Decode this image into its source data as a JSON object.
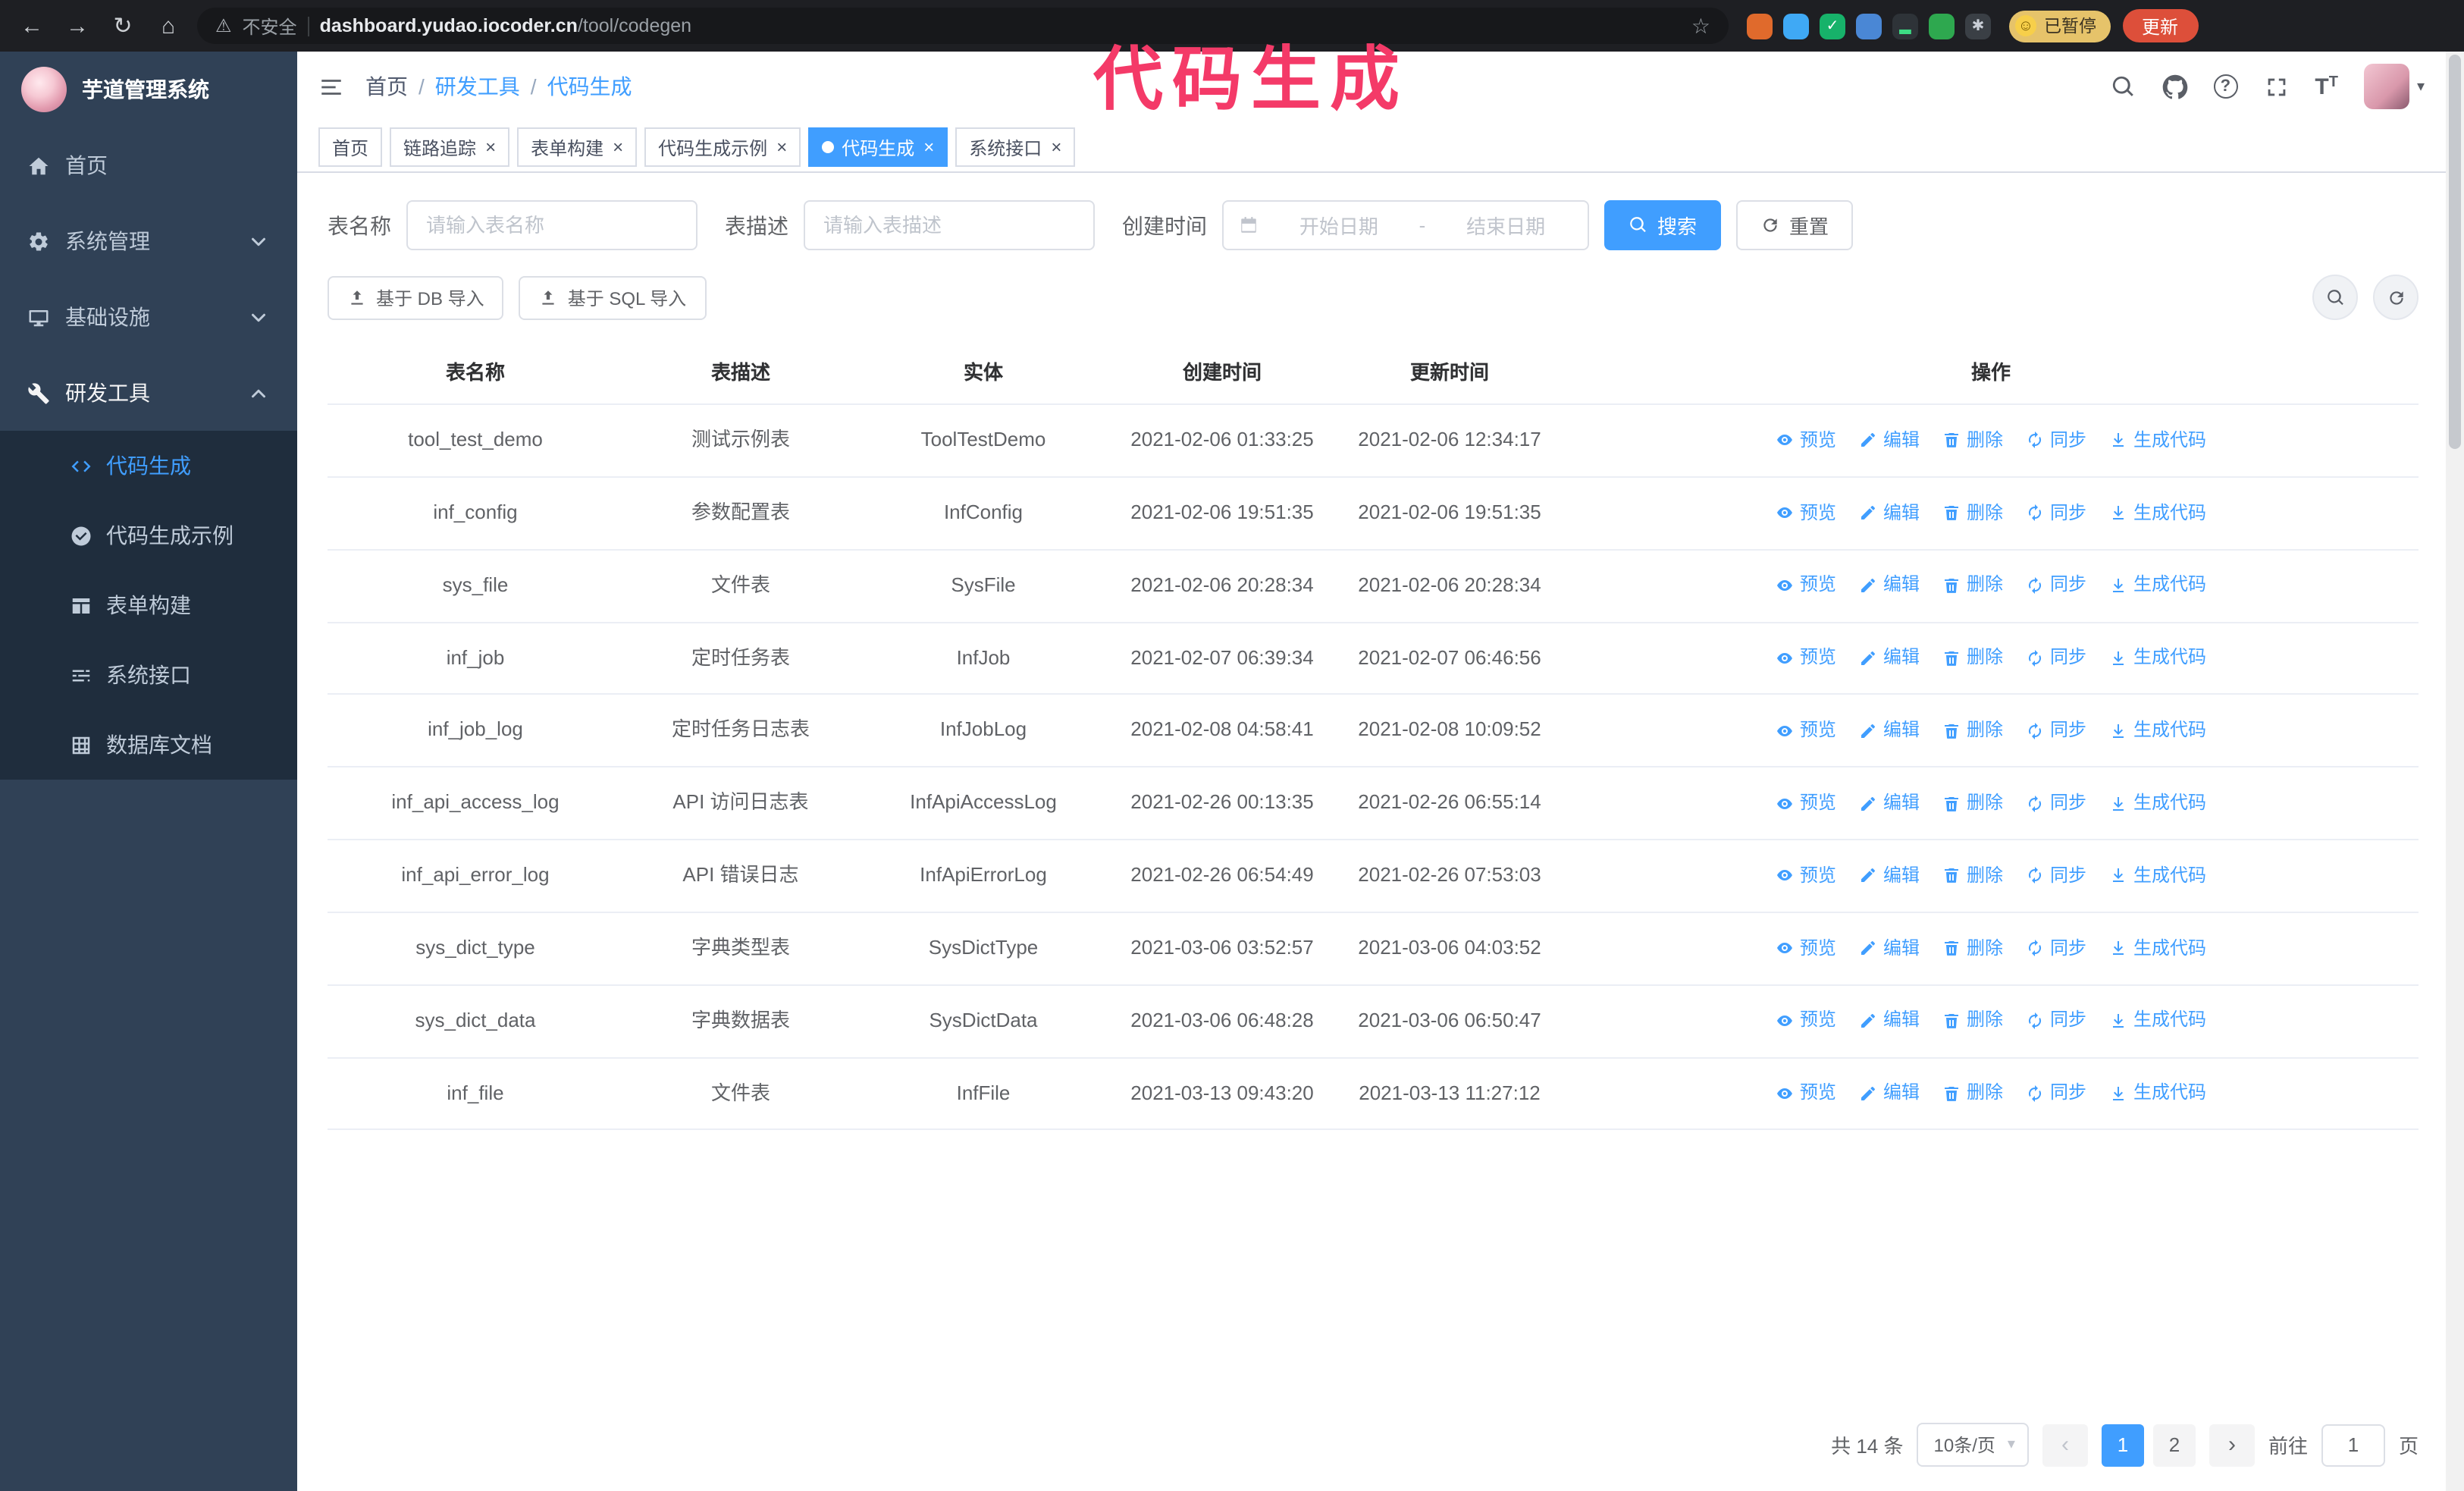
{
  "theme": {
    "primary": "#409eff"
  },
  "annotation": {
    "title": "代码生成",
    "color": "#f43a68"
  },
  "browser": {
    "security_label": "不安全",
    "url_host": "dashboard.yudao.iocoder.cn",
    "url_path": "/tool/codegen",
    "paused_badge": "已暂停",
    "update_button": "更新",
    "extensions": [
      {
        "name": "fox-extension",
        "color": "#e06a2c",
        "glyph": "",
        "glyph_color": "#ffffff"
      },
      {
        "name": "drop-extension",
        "color": "#3fa9f5",
        "glyph": "",
        "glyph_color": "#ffffff"
      },
      {
        "name": "check-extension",
        "color": "#17b26a",
        "glyph": "✓",
        "glyph_color": "#ffffff"
      },
      {
        "name": "people-extension",
        "color": "#4a87d5",
        "glyph": "",
        "glyph_color": "#ffffff"
      },
      {
        "name": "recorder-extension",
        "color": "#2e3338",
        "glyph": "▂",
        "glyph_color": "#3ddc84"
      },
      {
        "name": "leaf-extension",
        "color": "#2ea84f",
        "glyph": "",
        "glyph_color": "#ffffff"
      },
      {
        "name": "paw-extension",
        "color": "#3a3f45",
        "glyph": "✱",
        "glyph_color": "#c9ced6"
      }
    ]
  },
  "sidebar": {
    "logo_title": "芋道管理系统",
    "items": [
      {
        "id": "home",
        "label": "首页",
        "icon": "home"
      },
      {
        "id": "system",
        "label": "系统管理",
        "icon": "gear",
        "chevron": "down"
      },
      {
        "id": "infra",
        "label": "基础设施",
        "icon": "monitor",
        "chevron": "down"
      },
      {
        "id": "devtools",
        "label": "研发工具",
        "icon": "wrench",
        "chevron": "up",
        "open": true
      }
    ],
    "submenu": [
      {
        "id": "codegen",
        "label": "代码生成",
        "icon": "code",
        "active": true
      },
      {
        "id": "codegen-example",
        "label": "代码生成示例",
        "icon": "check-circle"
      },
      {
        "id": "form-builder",
        "label": "表单构建",
        "icon": "tableblk"
      },
      {
        "id": "api",
        "label": "系统接口",
        "icon": "sliders"
      },
      {
        "id": "db-doc",
        "label": "数据库文档",
        "icon": "gridd"
      }
    ]
  },
  "header": {
    "breadcrumb": [
      "首页",
      "研发工具",
      "代码生成"
    ]
  },
  "tabs": [
    {
      "label": "首页",
      "closable": false
    },
    {
      "label": "链路追踪",
      "closable": true
    },
    {
      "label": "表单构建",
      "closable": true
    },
    {
      "label": "代码生成示例",
      "closable": true
    },
    {
      "label": "代码生成",
      "closable": true,
      "active": true
    },
    {
      "label": "系统接口",
      "closable": true
    }
  ],
  "filters": {
    "table_name_label": "表名称",
    "table_name_placeholder": "请输入表名称",
    "table_desc_label": "表描述",
    "table_desc_placeholder": "请输入表描述",
    "create_time_label": "创建时间",
    "date_start_placeholder": "开始日期",
    "date_separator": "-",
    "date_end_placeholder": "结束日期",
    "search_button": "搜索",
    "reset_button": "重置"
  },
  "toolbar": {
    "import_db": "基于 DB 导入",
    "import_sql": "基于 SQL 导入"
  },
  "table": {
    "columns": [
      "表名称",
      "表描述",
      "实体",
      "创建时间",
      "更新时间",
      "操作"
    ],
    "op_labels": [
      "预览",
      "编辑",
      "删除",
      "同步",
      "生成代码"
    ],
    "rows": [
      {
        "name": "tool_test_demo",
        "desc": "测试示例表",
        "entity": "ToolTestDemo",
        "created": "2021-02-06 01:33:25",
        "updated": "2021-02-06 12:34:17"
      },
      {
        "name": "inf_config",
        "desc": "参数配置表",
        "entity": "InfConfig",
        "created": "2021-02-06 19:51:35",
        "updated": "2021-02-06 19:51:35"
      },
      {
        "name": "sys_file",
        "desc": "文件表",
        "entity": "SysFile",
        "created": "2021-02-06 20:28:34",
        "updated": "2021-02-06 20:28:34"
      },
      {
        "name": "inf_job",
        "desc": "定时任务表",
        "entity": "InfJob",
        "created": "2021-02-07 06:39:34",
        "updated": "2021-02-07 06:46:56"
      },
      {
        "name": "inf_job_log",
        "desc": "定时任务日志表",
        "entity": "InfJobLog",
        "created": "2021-02-08 04:58:41",
        "updated": "2021-02-08 10:09:52"
      },
      {
        "name": "inf_api_access_log",
        "desc": "API 访问日志表",
        "entity": "InfApiAccessLog",
        "created": "2021-02-26 00:13:35",
        "updated": "2021-02-26 06:55:14"
      },
      {
        "name": "inf_api_error_log",
        "desc": "API 错误日志",
        "entity": "InfApiErrorLog",
        "created": "2021-02-26 06:54:49",
        "updated": "2021-02-26 07:53:03"
      },
      {
        "name": "sys_dict_type",
        "desc": "字典类型表",
        "entity": "SysDictType",
        "created": "2021-03-06 03:52:57",
        "updated": "2021-03-06 04:03:52"
      },
      {
        "name": "sys_dict_data",
        "desc": "字典数据表",
        "entity": "SysDictData",
        "created": "2021-03-06 06:48:28",
        "updated": "2021-03-06 06:50:47"
      },
      {
        "name": "inf_file",
        "desc": "文件表",
        "entity": "InfFile",
        "created": "2021-03-13 09:43:20",
        "updated": "2021-03-13 11:27:12"
      }
    ]
  },
  "pagination": {
    "total_text": "共 14 条",
    "page_size": "10条/页",
    "pages": [
      "1",
      "2"
    ],
    "current": "1",
    "goto_label": "前往",
    "goto_value": "1",
    "page_unit": "页"
  }
}
